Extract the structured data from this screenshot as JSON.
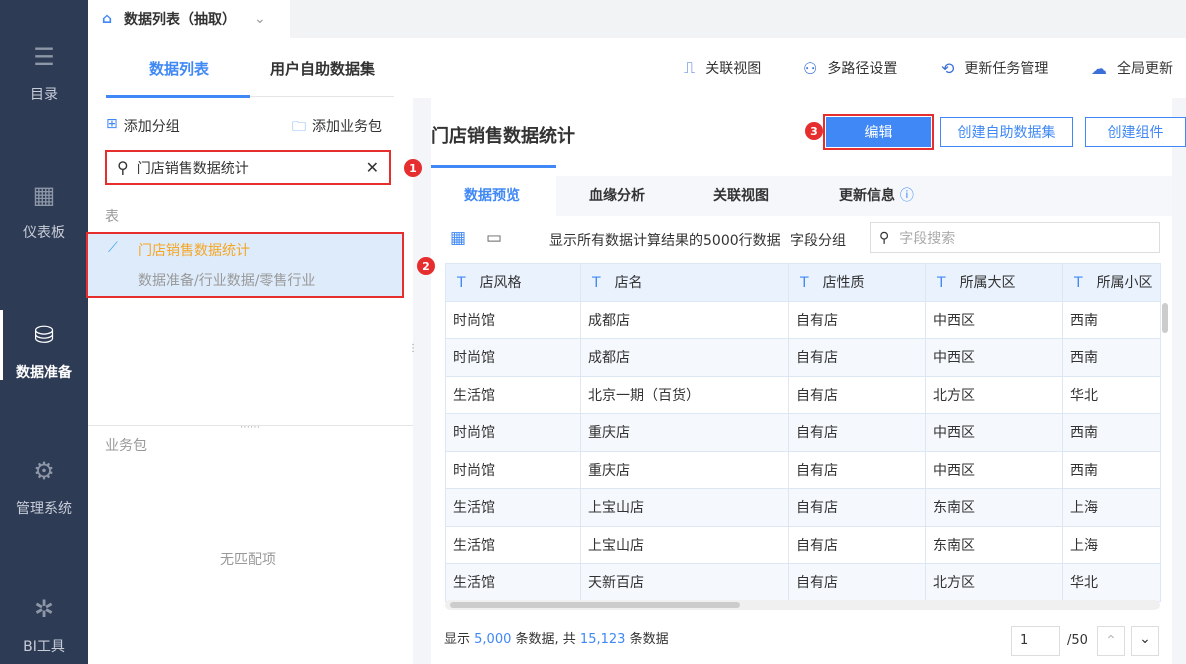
{
  "sidebar": {
    "items": [
      {
        "label": "目录",
        "icon": "list-icon"
      },
      {
        "label": "仪表板",
        "icon": "dashboard-icon"
      },
      {
        "label": "数据准备",
        "icon": "database-icon",
        "active": true
      },
      {
        "label": "管理系统",
        "icon": "gear-icon"
      },
      {
        "label": "BI工具",
        "icon": "network-icon"
      }
    ]
  },
  "top_tab": {
    "label": "数据列表（抽取）"
  },
  "left_tabs": [
    "数据列表",
    "用户自助数据集"
  ],
  "toolbar": [
    "关联视图",
    "多路径设置",
    "更新任务管理",
    "全局更新"
  ],
  "left": {
    "add_group": "添加分组",
    "add_package": "添加业务包",
    "search_value": "门店销售数据统计",
    "section_table": "表",
    "result_name": "门店销售数据统计",
    "result_path": "数据准备/行业数据/零售行业",
    "section_package": "业务包",
    "empty": "无匹配项"
  },
  "detail": {
    "title": "门店销售数据统计",
    "edit": "编辑",
    "create_dataset": "创建自助数据集",
    "create_component": "创建组件",
    "tabs": [
      "数据预览",
      "血缘分析",
      "关联视图",
      "更新信息"
    ],
    "info_text": "显示所有数据计算结果的5000行数据",
    "field_group": "字段分组",
    "field_search_placeholder": "字段搜索"
  },
  "table": {
    "columns": [
      "店风格",
      "店名",
      "店性质",
      "所属大区",
      "所属小区"
    ],
    "rows": [
      [
        "时尚馆",
        "成都店",
        "自有店",
        "中西区",
        "西南"
      ],
      [
        "时尚馆",
        "成都店",
        "自有店",
        "中西区",
        "西南"
      ],
      [
        "生活馆",
        "北京一期（百货）",
        "自有店",
        "北方区",
        "华北"
      ],
      [
        "时尚馆",
        "重庆店",
        "自有店",
        "中西区",
        "西南"
      ],
      [
        "时尚馆",
        "重庆店",
        "自有店",
        "中西区",
        "西南"
      ],
      [
        "生活馆",
        "上宝山店",
        "自有店",
        "东南区",
        "上海"
      ],
      [
        "生活馆",
        "上宝山店",
        "自有店",
        "东南区",
        "上海"
      ],
      [
        "生活馆",
        "天新百店",
        "自有店",
        "北方区",
        "华北"
      ]
    ]
  },
  "footer": {
    "p1": "显示",
    "shown": "5,000",
    "p2": "条数据, 共",
    "total": "15,123",
    "p3": "条数据",
    "page": "1",
    "pages": "/50"
  },
  "badges": [
    "1",
    "2",
    "3"
  ],
  "colors": {
    "accent": "#3f88f5",
    "sidebar": "#2e3b55",
    "highlight": "#e62e2e",
    "result_name": "#f5a623"
  }
}
